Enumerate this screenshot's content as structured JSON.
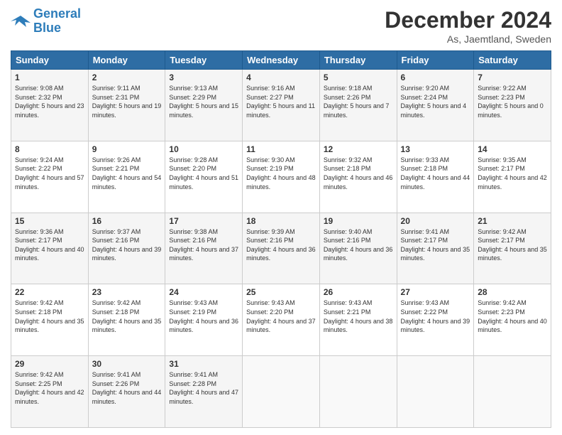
{
  "header": {
    "logo_line1": "General",
    "logo_line2": "Blue",
    "month": "December 2024",
    "location": "As, Jaemtland, Sweden"
  },
  "weekdays": [
    "Sunday",
    "Monday",
    "Tuesday",
    "Wednesday",
    "Thursday",
    "Friday",
    "Saturday"
  ],
  "weeks": [
    [
      {
        "day": "1",
        "sunrise": "9:08 AM",
        "sunset": "2:32 PM",
        "daylight": "5 hours and 23 minutes."
      },
      {
        "day": "2",
        "sunrise": "9:11 AM",
        "sunset": "2:31 PM",
        "daylight": "5 hours and 19 minutes."
      },
      {
        "day": "3",
        "sunrise": "9:13 AM",
        "sunset": "2:29 PM",
        "daylight": "5 hours and 15 minutes."
      },
      {
        "day": "4",
        "sunrise": "9:16 AM",
        "sunset": "2:27 PM",
        "daylight": "5 hours and 11 minutes."
      },
      {
        "day": "5",
        "sunrise": "9:18 AM",
        "sunset": "2:26 PM",
        "daylight": "5 hours and 7 minutes."
      },
      {
        "day": "6",
        "sunrise": "9:20 AM",
        "sunset": "2:24 PM",
        "daylight": "5 hours and 4 minutes."
      },
      {
        "day": "7",
        "sunrise": "9:22 AM",
        "sunset": "2:23 PM",
        "daylight": "5 hours and 0 minutes."
      }
    ],
    [
      {
        "day": "8",
        "sunrise": "9:24 AM",
        "sunset": "2:22 PM",
        "daylight": "4 hours and 57 minutes."
      },
      {
        "day": "9",
        "sunrise": "9:26 AM",
        "sunset": "2:21 PM",
        "daylight": "4 hours and 54 minutes."
      },
      {
        "day": "10",
        "sunrise": "9:28 AM",
        "sunset": "2:20 PM",
        "daylight": "4 hours and 51 minutes."
      },
      {
        "day": "11",
        "sunrise": "9:30 AM",
        "sunset": "2:19 PM",
        "daylight": "4 hours and 48 minutes."
      },
      {
        "day": "12",
        "sunrise": "9:32 AM",
        "sunset": "2:18 PM",
        "daylight": "4 hours and 46 minutes."
      },
      {
        "day": "13",
        "sunrise": "9:33 AM",
        "sunset": "2:18 PM",
        "daylight": "4 hours and 44 minutes."
      },
      {
        "day": "14",
        "sunrise": "9:35 AM",
        "sunset": "2:17 PM",
        "daylight": "4 hours and 42 minutes."
      }
    ],
    [
      {
        "day": "15",
        "sunrise": "9:36 AM",
        "sunset": "2:17 PM",
        "daylight": "4 hours and 40 minutes."
      },
      {
        "day": "16",
        "sunrise": "9:37 AM",
        "sunset": "2:16 PM",
        "daylight": "4 hours and 39 minutes."
      },
      {
        "day": "17",
        "sunrise": "9:38 AM",
        "sunset": "2:16 PM",
        "daylight": "4 hours and 37 minutes."
      },
      {
        "day": "18",
        "sunrise": "9:39 AM",
        "sunset": "2:16 PM",
        "daylight": "4 hours and 36 minutes."
      },
      {
        "day": "19",
        "sunrise": "9:40 AM",
        "sunset": "2:16 PM",
        "daylight": "4 hours and 36 minutes."
      },
      {
        "day": "20",
        "sunrise": "9:41 AM",
        "sunset": "2:17 PM",
        "daylight": "4 hours and 35 minutes."
      },
      {
        "day": "21",
        "sunrise": "9:42 AM",
        "sunset": "2:17 PM",
        "daylight": "4 hours and 35 minutes."
      }
    ],
    [
      {
        "day": "22",
        "sunrise": "9:42 AM",
        "sunset": "2:18 PM",
        "daylight": "4 hours and 35 minutes."
      },
      {
        "day": "23",
        "sunrise": "9:42 AM",
        "sunset": "2:18 PM",
        "daylight": "4 hours and 35 minutes."
      },
      {
        "day": "24",
        "sunrise": "9:43 AM",
        "sunset": "2:19 PM",
        "daylight": "4 hours and 36 minutes."
      },
      {
        "day": "25",
        "sunrise": "9:43 AM",
        "sunset": "2:20 PM",
        "daylight": "4 hours and 37 minutes."
      },
      {
        "day": "26",
        "sunrise": "9:43 AM",
        "sunset": "2:21 PM",
        "daylight": "4 hours and 38 minutes."
      },
      {
        "day": "27",
        "sunrise": "9:43 AM",
        "sunset": "2:22 PM",
        "daylight": "4 hours and 39 minutes."
      },
      {
        "day": "28",
        "sunrise": "9:42 AM",
        "sunset": "2:23 PM",
        "daylight": "4 hours and 40 minutes."
      }
    ],
    [
      {
        "day": "29",
        "sunrise": "9:42 AM",
        "sunset": "2:25 PM",
        "daylight": "4 hours and 42 minutes."
      },
      {
        "day": "30",
        "sunrise": "9:41 AM",
        "sunset": "2:26 PM",
        "daylight": "4 hours and 44 minutes."
      },
      {
        "day": "31",
        "sunrise": "9:41 AM",
        "sunset": "2:28 PM",
        "daylight": "4 hours and 47 minutes."
      },
      null,
      null,
      null,
      null
    ]
  ]
}
